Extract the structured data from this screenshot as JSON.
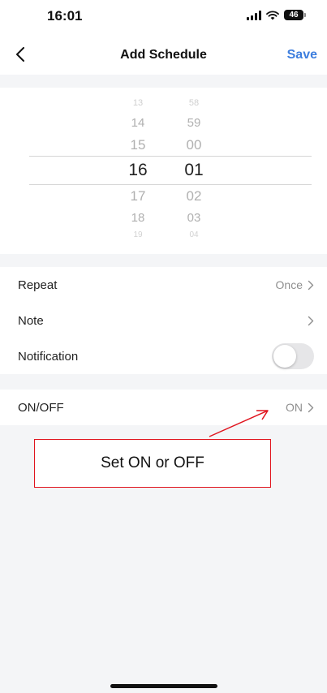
{
  "status_bar": {
    "time": "16:01",
    "battery": "46"
  },
  "nav": {
    "title": "Add Schedule",
    "save_label": "Save",
    "back_icon": "chevron-left-icon"
  },
  "time_picker": {
    "hours": [
      "13",
      "14",
      "15",
      "16",
      "17",
      "18",
      "19"
    ],
    "minutes": [
      "58",
      "59",
      "00",
      "01",
      "02",
      "03",
      "04"
    ],
    "selected_hour": "16",
    "selected_minute": "01"
  },
  "settings": {
    "repeat": {
      "label": "Repeat",
      "value": "Once"
    },
    "note": {
      "label": "Note"
    },
    "notification": {
      "label": "Notification",
      "enabled": false
    }
  },
  "onoff": {
    "label": "ON/OFF",
    "value": "ON"
  },
  "annotation": {
    "text": "Set ON or OFF",
    "color": "#e0141e"
  },
  "colors": {
    "accent": "#3d7ede",
    "background": "#f4f5f7"
  }
}
